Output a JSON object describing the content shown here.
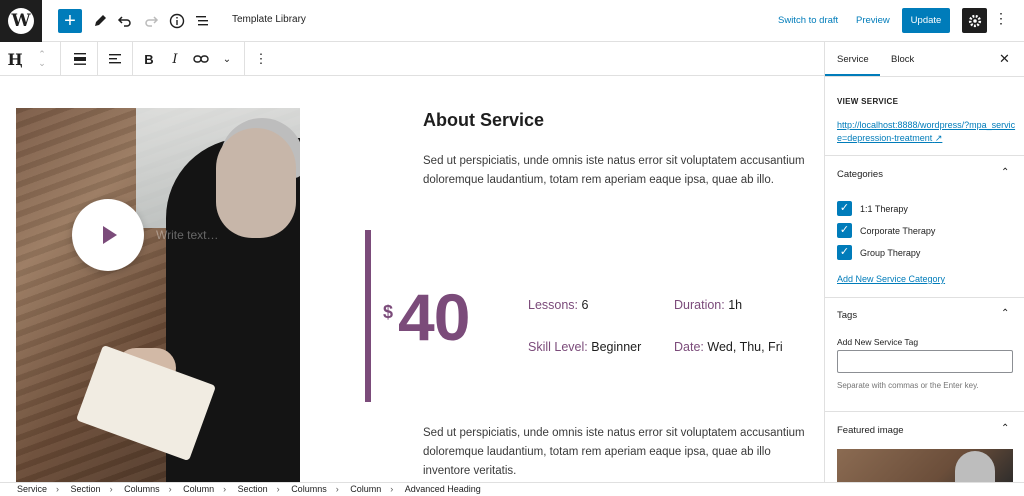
{
  "topbar": {
    "logo": "W",
    "document_title": "Template Library",
    "switch_to_draft": "Switch to draft",
    "preview": "Preview",
    "update": "Update"
  },
  "block_toolbar": {
    "block_icon": "Ⱨ"
  },
  "content": {
    "write_placeholder": "Write text…",
    "heading": "About Service",
    "paragraph1": "Sed ut perspiciatis, unde omnis iste natus error sit voluptatem accusantium doloremque laudantium, totam rem aperiam eaque ipsa, quae ab illo.",
    "price_currency": "$",
    "price_value": "40",
    "lessons_label": "Lessons:",
    "lessons_value": "6",
    "duration_label": "Duration:",
    "duration_value": "1h",
    "skill_label": "Skill Level:",
    "skill_value": "Beginner",
    "date_label": "Date:",
    "date_value": "Wed, Thu, Fri",
    "paragraph2": "Sed ut perspiciatis, unde omnis iste natus error sit voluptatem accusantium doloremque laudantium, totam rem aperiam eaque ipsa, quae ab illo inventore veritatis.",
    "accent_color": "#7b4b7a"
  },
  "breadcrumbs": [
    "Service",
    "Section",
    "Columns",
    "Column",
    "Section",
    "Columns",
    "Column",
    "Advanced Heading"
  ],
  "sidebar": {
    "tab_service": "Service",
    "tab_block": "Block",
    "view_service_label": "VIEW SERVICE",
    "view_service_url": "http://localhost:8888/wordpress/?mpa_service=depression-treatment",
    "categories_heading": "Categories",
    "categories": [
      {
        "label": "1:1 Therapy",
        "checked": true
      },
      {
        "label": "Corporate Therapy",
        "checked": true
      },
      {
        "label": "Group Therapy",
        "checked": true
      }
    ],
    "add_category": "Add New Service Category",
    "tags_heading": "Tags",
    "add_tag_label": "Add New Service Tag",
    "tag_help": "Separate with commas or the Enter key.",
    "featured_heading": "Featured image"
  }
}
